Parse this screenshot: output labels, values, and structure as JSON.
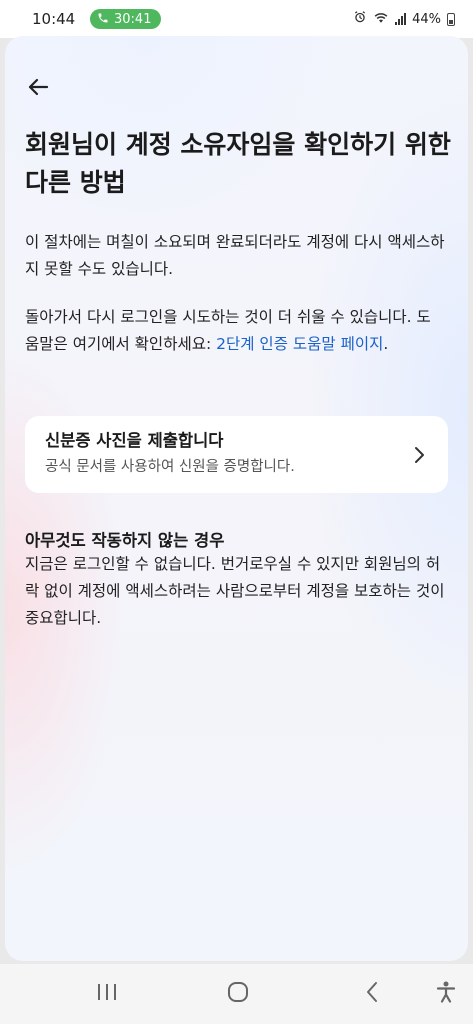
{
  "status_bar": {
    "time": "10:44",
    "call_duration": "30:41",
    "battery": "44%"
  },
  "header": {
    "back_icon": "arrow-left-icon",
    "title": "회원님이 계정 소유자임을 확인하기 위한 다른 방법"
  },
  "body": {
    "paragraph1": "이 절차에는 며칠이 소요되며 완료되더라도 계정에 다시 액세스하지 못할 수도 있습니다.",
    "paragraph2_prefix": "돌아가서 다시 로그인을 시도하는 것이 더 쉬울 수 있습니다. 도움말은 여기에서 확인하세요: ",
    "paragraph2_link": "2단계 인증 도움말 페이지",
    "paragraph2_suffix": "."
  },
  "option": {
    "title": "신분증 사진을 제출합니다",
    "subtitle": "공식 문서를 사용하여 신원을 증명합니다.",
    "icon": "chevron-right-icon"
  },
  "fallback": {
    "title": "아무것도 작동하지 않는 경우",
    "text": "지금은 로그인할 수 없습니다. 번거로우실 수 있지만 회원님의 허락 없이 계정에 액세스하려는 사람으로부터 계정을 보호하는 것이 중요합니다."
  },
  "colors": {
    "link": "#1a62c9",
    "call_pill": "#4fb85f"
  }
}
